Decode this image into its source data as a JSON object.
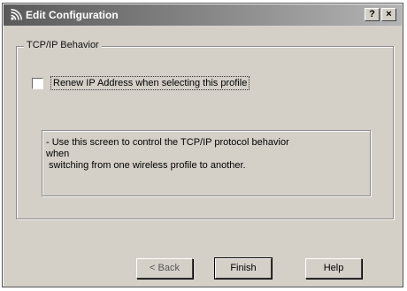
{
  "window": {
    "title": "Edit Configuration",
    "title_icon": "wireless-signal-icon",
    "help_button": "?",
    "close_button": "×"
  },
  "group": {
    "label": "TCP/IP Behavior",
    "checkbox_label": "Renew IP Address when selecting this profile",
    "checkbox_checked": false,
    "info_text": "- Use this screen to control the TCP/IP protocol behavior\nwhen\n switching from one wireless profile to another."
  },
  "buttons": {
    "back": "< Back",
    "finish": "Finish",
    "help": "Help"
  }
}
